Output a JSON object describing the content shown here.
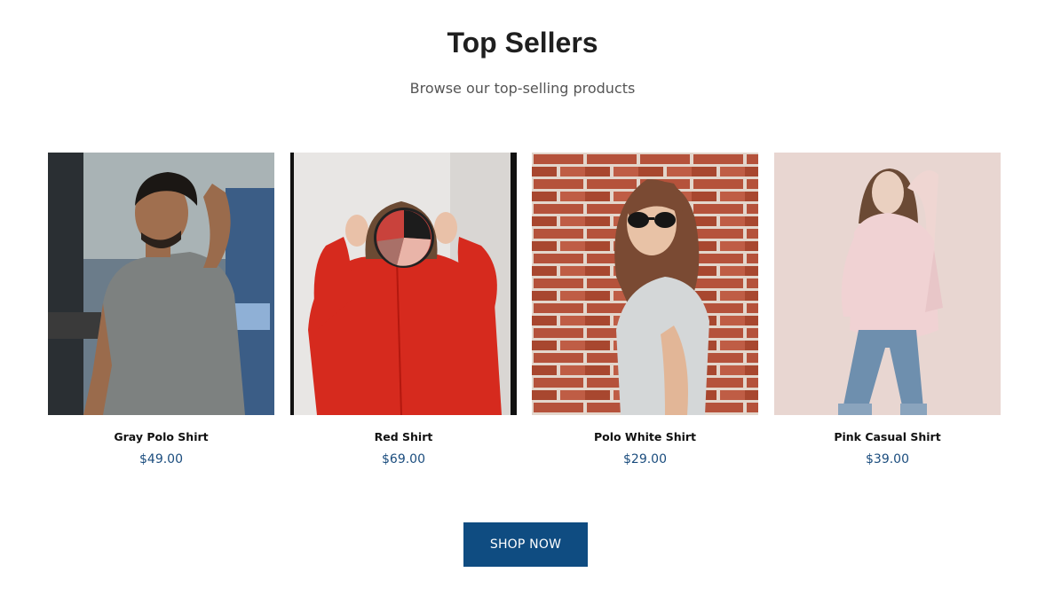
{
  "section": {
    "title": "Top Sellers",
    "subtitle": "Browse our top-selling products"
  },
  "products": [
    {
      "name": "Gray Polo Shirt",
      "price": "$49.00",
      "image": "man-gray-tshirt-photo"
    },
    {
      "name": "Red Shirt",
      "price": "$69.00",
      "image": "woman-red-shirt-photo"
    },
    {
      "name": "Polo White Shirt",
      "price": "$29.00",
      "image": "woman-brick-wall-photo"
    },
    {
      "name": "Pink Casual Shirt",
      "price": "$39.00",
      "image": "woman-pink-shirt-photo"
    }
  ],
  "cta": {
    "label": "SHOP NOW"
  },
  "colors": {
    "accent": "#0f4c81",
    "price": "#1b4d7e",
    "title": "#1f1f1f"
  }
}
